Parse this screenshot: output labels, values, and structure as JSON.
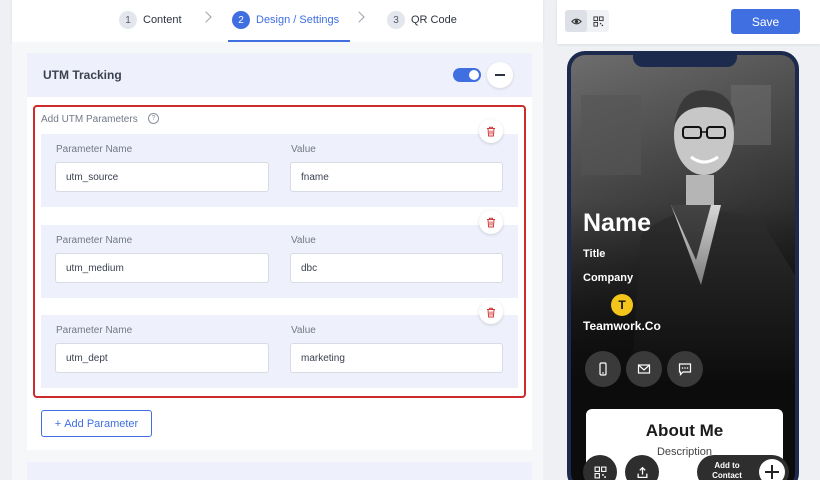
{
  "steps": [
    {
      "number": "1",
      "label": "Content"
    },
    {
      "number": "2",
      "label": "Design / Settings"
    },
    {
      "number": "3",
      "label": "QR Code"
    }
  ],
  "utm": {
    "title": "UTM Tracking",
    "enabled": true,
    "params_label": "Add UTM Parameters",
    "help_glyph": "?",
    "name_label": "Parameter Name",
    "value_label": "Value",
    "rows": [
      {
        "name": "utm_source",
        "value": "fname"
      },
      {
        "name": "utm_medium",
        "value": "dbc"
      },
      {
        "name": "utm_dept",
        "value": "marketing"
      }
    ],
    "add_button": "Add Parameter",
    "add_glyph": "+"
  },
  "preview": {
    "save_label": "Save",
    "card": {
      "name": "Name",
      "title": "Title",
      "company": "Company",
      "logo_letter": "T",
      "company_name": "Teamwork.Co",
      "about_title": "About Me",
      "about_desc": "Description",
      "add_contact_label": "Add to Contact"
    }
  },
  "colors": {
    "accent": "#3f6fe0",
    "danger": "#cc2b2b",
    "phone_frame": "#1c2a4d",
    "logo_yellow": "#f4c51a"
  },
  "icons": [
    "eye-icon",
    "qr-code-icon",
    "help-circle-icon",
    "trash-icon",
    "phone-icon",
    "mail-icon",
    "message-icon",
    "share-icon",
    "plus-icon"
  ]
}
